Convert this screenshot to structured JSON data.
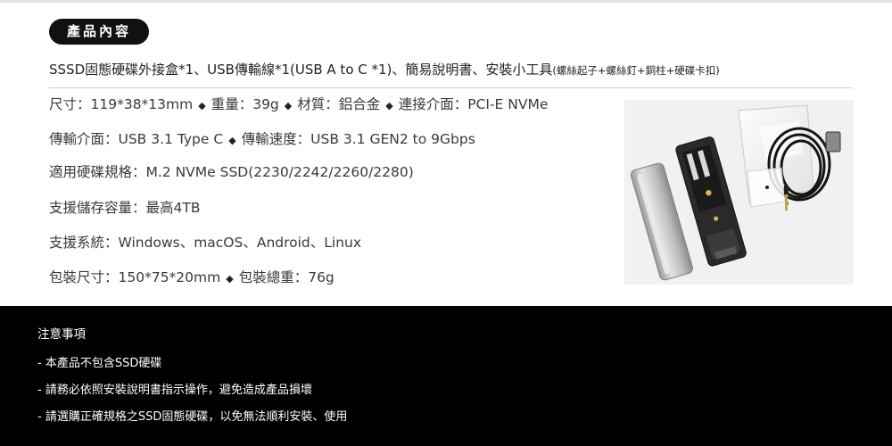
{
  "header": {
    "badge": "產品內容",
    "contents_main": "SSSD固態硬碟外接盒*1、USB傳輸線*1(USB A to C *1)、簡易說明書、安裝小工具",
    "contents_small": "(螺絲起子+螺絲釘+銅柱+硬碟卡扣)"
  },
  "specs": {
    "row1": [
      "尺寸：119*38*13mm",
      "重量：39g",
      "材質：鋁合金",
      "連接介面：PCI-E NVMe"
    ],
    "row2": [
      "傳輸介面：USB 3.1 Type C",
      "傳輸速度：USB 3.1 GEN2 to 9Gbps"
    ],
    "row3": "適用硬碟規格：M.2 NVMe SSD(2230/2242/2260/2280)",
    "row4": "支援儲存容量：最高4TB",
    "row5": "支援系統：Windows、macOS、Android、Linux",
    "row6": [
      "包裝尺寸：150*75*20mm",
      "包裝總重：76g"
    ],
    "separator": "◆"
  },
  "notice": {
    "title": "注意事項",
    "items": [
      "- 本產品不包含SSD硬碟",
      "- 請務必依照安裝說明書指示操作，避免造成產品損壞",
      "- 請選購正確規格之SSD固態硬碟，以免無法順利安裝、使用"
    ]
  }
}
